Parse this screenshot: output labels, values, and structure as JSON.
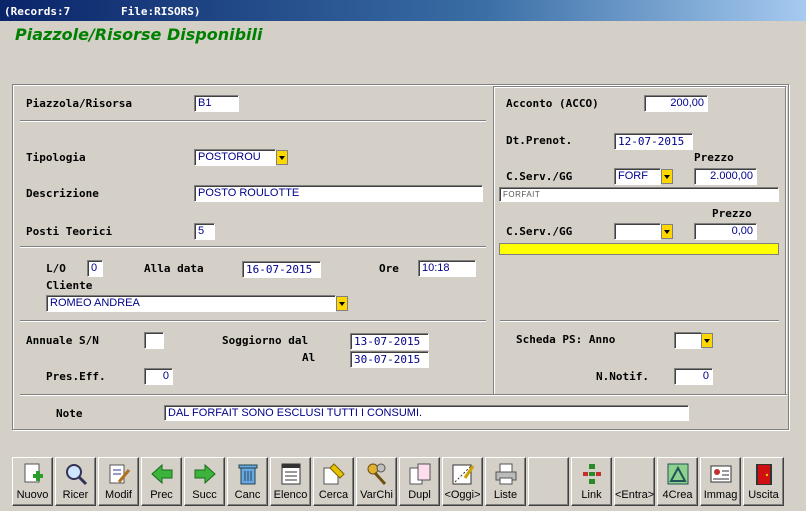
{
  "titlebar": {
    "records": "(Records:7",
    "file": "File:RISORS)"
  },
  "form_title": "Piazzole/Risorse Disponibili",
  "left": {
    "piazzola_label": "Piazzola/Risorsa",
    "piazzola_value": "B1",
    "tipologia_label": "Tipologia",
    "tipologia_value": "POSTOROU",
    "descrizione_label": "Descrizione",
    "descrizione_value": "POSTO ROULOTTE",
    "posti_label": "Posti Teorici",
    "posti_value": "5",
    "lo_label": "L/O",
    "lo_value": "0",
    "alla_data_label": "Alla data",
    "alla_data_value": "16-07-2015",
    "ore_label": "Ore",
    "ore_value": "10:18",
    "cliente_label": "Cliente",
    "cliente_value": "ROMEO ANDREA",
    "annuale_label": "Annuale S/N",
    "annuale_value": "",
    "soggiorno_label": "Soggiorno dal",
    "soggiorno_dal": "13-07-2015",
    "al_label": "Al",
    "al_value": "30-07-2015",
    "preseff_label": "Pres.Eff.",
    "preseff_value": "0"
  },
  "right": {
    "acconto_label": "Acconto (ACCO)",
    "acconto_value": "200,00",
    "dtprenot_label": "Dt.Prenot.",
    "dtprenot_value": "12-07-2015",
    "prezzo1_label": "Prezzo",
    "cserv1_label": "C.Serv./GG",
    "cserv1_value": "FORF",
    "prezzo1_value": "2.000,00",
    "cserv1_desc": "FORFAIT",
    "prezzo2_label": "Prezzo",
    "cserv2_label": "C.Serv./GG",
    "cserv2_value": "",
    "prezzo2_value": "0,00",
    "scheda_label": "Scheda PS: Anno",
    "scheda_value": "",
    "nnotif_label": "N.Notif.",
    "nnotif_value": "0"
  },
  "note": {
    "label": "Note",
    "value": "DAL FORFAIT SONO ESCLUSI TUTTI I CONSUMI."
  },
  "toolbar": [
    {
      "label": "Nuovo",
      "icon": "new-document-icon"
    },
    {
      "label": "Ricer",
      "icon": "magnifier-icon"
    },
    {
      "label": "Modif",
      "icon": "edit-document-icon"
    },
    {
      "label": "Prec",
      "icon": "arrow-left-icon"
    },
    {
      "label": "Succ",
      "icon": "arrow-right-icon"
    },
    {
      "label": "Canc",
      "icon": "trash-icon"
    },
    {
      "label": "Elenco",
      "icon": "list-icon"
    },
    {
      "label": "Cerca",
      "icon": "search-icon"
    },
    {
      "label": "VarChi",
      "icon": "keys-icon"
    },
    {
      "label": "Dupl",
      "icon": "duplicate-icon"
    },
    {
      "label": "<Oggi>",
      "icon": "calendar-icon"
    },
    {
      "label": "Liste",
      "icon": "printer-icon"
    },
    {
      "label": "",
      "icon": ""
    },
    {
      "label": "Link",
      "icon": "link-icon"
    },
    {
      "label": "<Entra>",
      "icon": ""
    },
    {
      "label": "4Crea",
      "icon": "create-icon"
    },
    {
      "label": "Immag",
      "icon": "image-card-icon"
    },
    {
      "label": "Uscita",
      "icon": "exit-door-icon"
    }
  ],
  "colors": {
    "accent_title": "#008000",
    "field_text": "#00008b",
    "dropdown": "#ffd700",
    "highlight_bar": "#ffff00"
  }
}
